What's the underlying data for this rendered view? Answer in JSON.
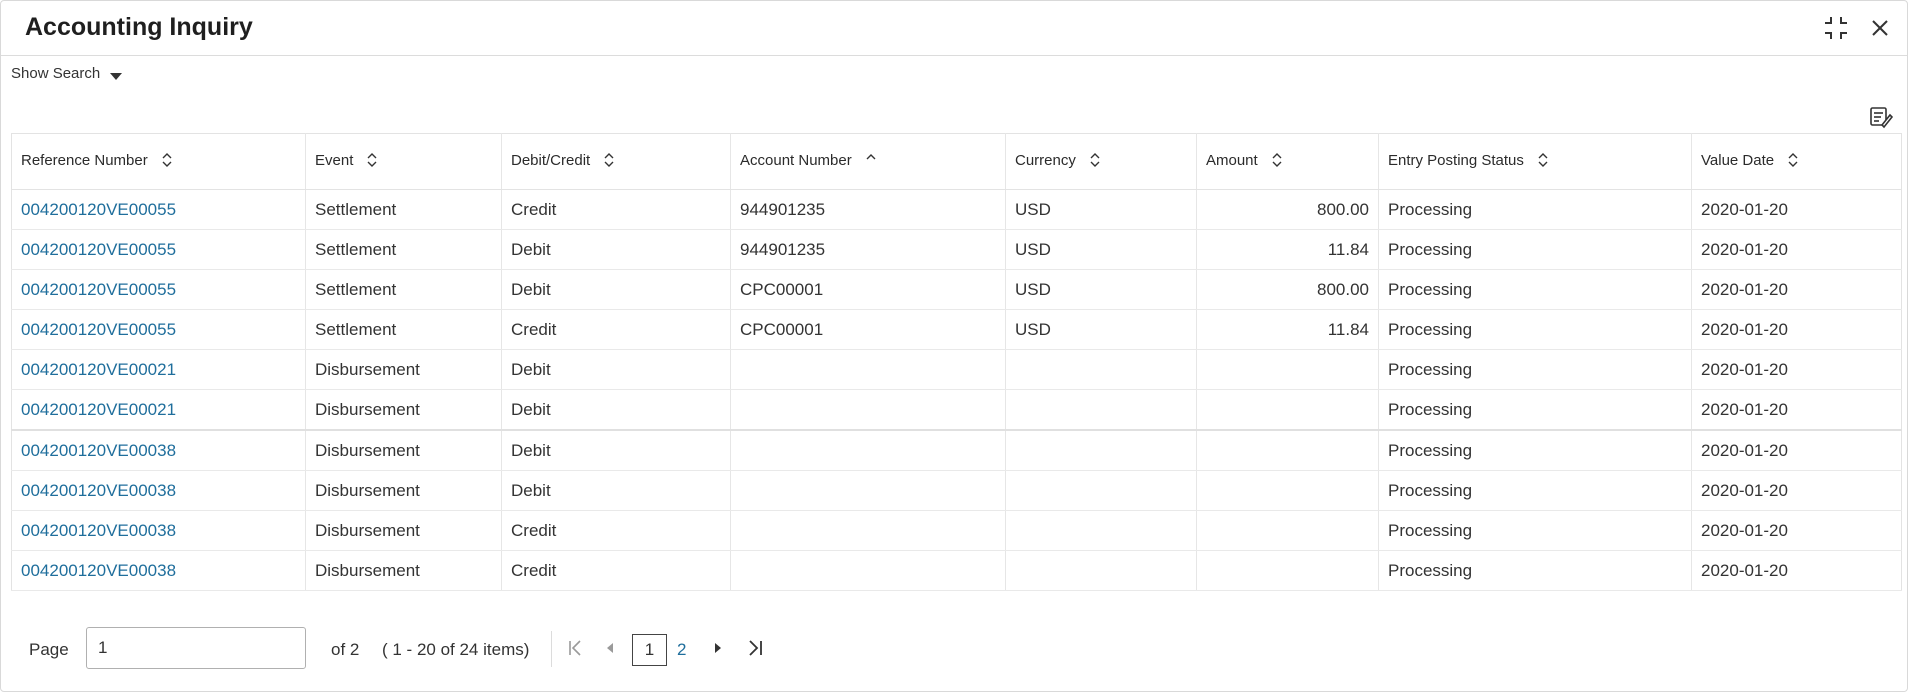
{
  "window": {
    "title": "Accounting Inquiry"
  },
  "search": {
    "toggle_label": "Show Search"
  },
  "table": {
    "headers": [
      "Reference Number",
      "Event",
      "Debit/Credit",
      "Account Number",
      "Currency",
      "Amount",
      "Entry Posting Status",
      "Value Date"
    ],
    "rows": [
      [
        "004200120VE00055",
        "Settlement",
        "Credit",
        "944901235",
        "USD",
        "800.00",
        "Processing",
        "2020-01-20"
      ],
      [
        "004200120VE00055",
        "Settlement",
        "Debit",
        "944901235",
        "USD",
        "11.84",
        "Processing",
        "2020-01-20"
      ],
      [
        "004200120VE00055",
        "Settlement",
        "Debit",
        "CPC00001",
        "USD",
        "800.00",
        "Processing",
        "2020-01-20"
      ],
      [
        "004200120VE00055",
        "Settlement",
        "Credit",
        "CPC00001",
        "USD",
        "11.84",
        "Processing",
        "2020-01-20"
      ],
      [
        "004200120VE00021",
        "Disbursement",
        "Debit",
        "",
        "",
        "",
        "Processing",
        "2020-01-20"
      ],
      [
        "004200120VE00021",
        "Disbursement",
        "Debit",
        "",
        "",
        "",
        "Processing",
        "2020-01-20"
      ],
      [
        "004200120VE00038",
        "Disbursement",
        "Debit",
        "",
        "",
        "",
        "Processing",
        "2020-01-20"
      ],
      [
        "004200120VE00038",
        "Disbursement",
        "Debit",
        "",
        "",
        "",
        "Processing",
        "2020-01-20"
      ],
      [
        "004200120VE00038",
        "Disbursement",
        "Credit",
        "",
        "",
        "",
        "Processing",
        "2020-01-20"
      ],
      [
        "004200120VE00038",
        "Disbursement",
        "Credit",
        "",
        "",
        "",
        "Processing",
        "2020-01-20"
      ]
    ]
  },
  "pagination": {
    "page_label": "Page",
    "current_page": "1",
    "of_label": "of 2",
    "items_label": "( 1 - 20 of 24 items)",
    "pages": [
      "1",
      "2"
    ]
  },
  "colors": {
    "link": "#1f6e9c",
    "border": "#e3e3e3"
  }
}
